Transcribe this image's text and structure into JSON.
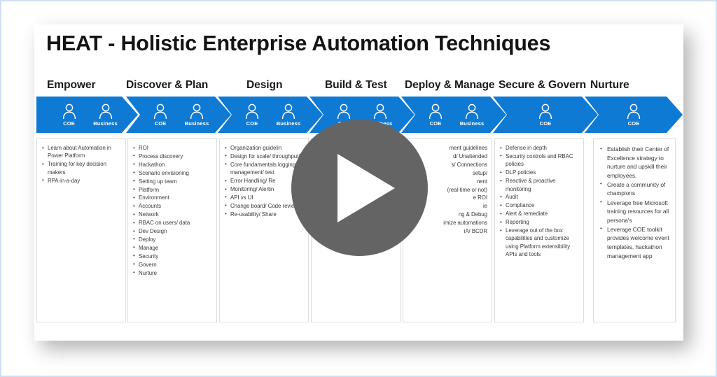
{
  "slide": {
    "title": "HEAT - Holistic Enterprise Automation Techniques"
  },
  "player": {
    "play_button_label": "Play",
    "play_icon": "play-triangle-icon",
    "overlay_color": "#646464"
  },
  "theme": {
    "chevron_blue": "#0f7ad4",
    "panel_background": "#ffffff",
    "frame_border": "#cfe0f2",
    "bullet_text": "#3a3a3a"
  },
  "stages": [
    {
      "id": "empower",
      "heading": "Empower",
      "personas": [
        "COE",
        "Business"
      ],
      "bullets": [
        "Learn about Automation in Power Platform",
        "Training for key decision makers",
        "RPA-in-a-day"
      ]
    },
    {
      "id": "discover-plan",
      "heading": "Discover & Plan",
      "personas": [
        "COE",
        "Business"
      ],
      "bullets": [
        "ROI",
        "Process discovery",
        "Hackathon",
        "Scenario envisioning",
        "Setting up team",
        "Platform",
        "Environment",
        "Accounts",
        "Network",
        "RBAC on users/ data",
        "Dev Design",
        "Deploy",
        "Manage",
        "Security",
        "Govern",
        "Nurture"
      ]
    },
    {
      "id": "design",
      "heading": "Design",
      "personas": [
        "COE",
        "Business"
      ],
      "bullets": [
        "Organization guidelin",
        "Design for scale/ throughput/ resilier",
        "Core fundamentals logging/ credentia management/ test",
        "Error Handling/ Re",
        "Monitoring/ Alertin",
        "API vs UI",
        "Change board/ Code review",
        "Re-usability/ Share"
      ]
    },
    {
      "id": "build-test",
      "heading": "Build & Test",
      "personas": [
        "COE",
        "Business"
      ],
      "bullets": []
    },
    {
      "id": "deploy-manage",
      "heading": "Deploy & Manage",
      "personas": [
        "COE",
        "Business"
      ],
      "bullets": [
        "ment guidelines",
        "d/ Unattended",
        "s/ Connections",
        "setup/",
        "nent",
        "(real-time or not)",
        "e ROI",
        "ie",
        "ng & Debug",
        "imize automations",
        "iA/ BCDR"
      ]
    },
    {
      "id": "secure-govern",
      "heading": "Secure & Govern",
      "personas": [
        "COE"
      ],
      "bullets": [
        "Defense in depth",
        "Security controls and RBAC policies",
        "DLP policies",
        "Reactive & proactive monitoring",
        "Audit",
        "Compliance",
        "Alert & remediate",
        "Reporting",
        "Leverage out of the box capabilities and customize using Platform extensibility APIs and tools"
      ]
    },
    {
      "id": "nurture",
      "heading": "Nurture",
      "personas": [
        "COE"
      ],
      "bullets": [
        "Establish their Center of Excellence strategy to nurture and upskill their employees.",
        "Create a community of champions",
        "Leverage free Microsoft training resources for all persona's",
        "Leverage COE toolkit provides welcome event templates, hackathon management app"
      ]
    }
  ]
}
